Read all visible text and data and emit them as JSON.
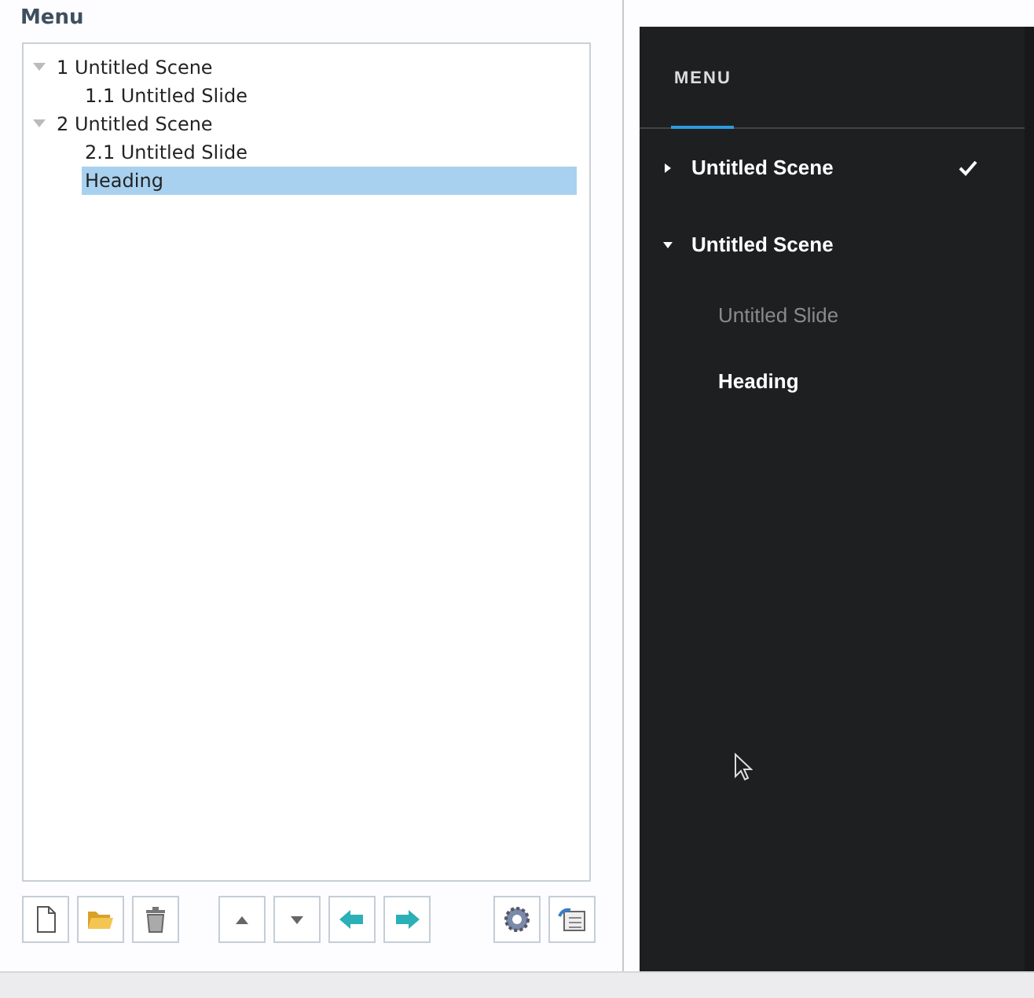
{
  "editor": {
    "title": "Menu",
    "tree": [
      {
        "label": "1 Untitled Scene",
        "expanded": true,
        "selected": false,
        "children": [
          {
            "label": "1.1 Untitled Slide",
            "selected": false
          }
        ]
      },
      {
        "label": "2 Untitled Scene",
        "expanded": true,
        "selected": false,
        "children": [
          {
            "label": "2.1 Untitled Slide",
            "selected": false
          },
          {
            "label": "Heading",
            "selected": true
          }
        ]
      }
    ],
    "toolbar": [
      {
        "buttons": [
          {
            "kind": "new"
          },
          {
            "kind": "open"
          },
          {
            "kind": "delete"
          }
        ]
      },
      {
        "buttons": [
          {
            "kind": "up"
          },
          {
            "kind": "down"
          },
          {
            "kind": "outdent"
          },
          {
            "kind": "indent"
          }
        ]
      },
      {
        "buttons": [
          {
            "kind": "settings"
          },
          {
            "kind": "import"
          }
        ]
      }
    ]
  },
  "preview": {
    "tab": {
      "label": "MENU",
      "selected": true
    },
    "items": [
      {
        "label": "Untitled Scene",
        "expanded": false,
        "checked": true
      },
      {
        "label": "Untitled Scene",
        "expanded": true,
        "checked": false,
        "children": [
          {
            "label": "Untitled Slide",
            "selected": false
          },
          {
            "label": "Heading",
            "selected": true
          }
        ]
      }
    ]
  }
}
